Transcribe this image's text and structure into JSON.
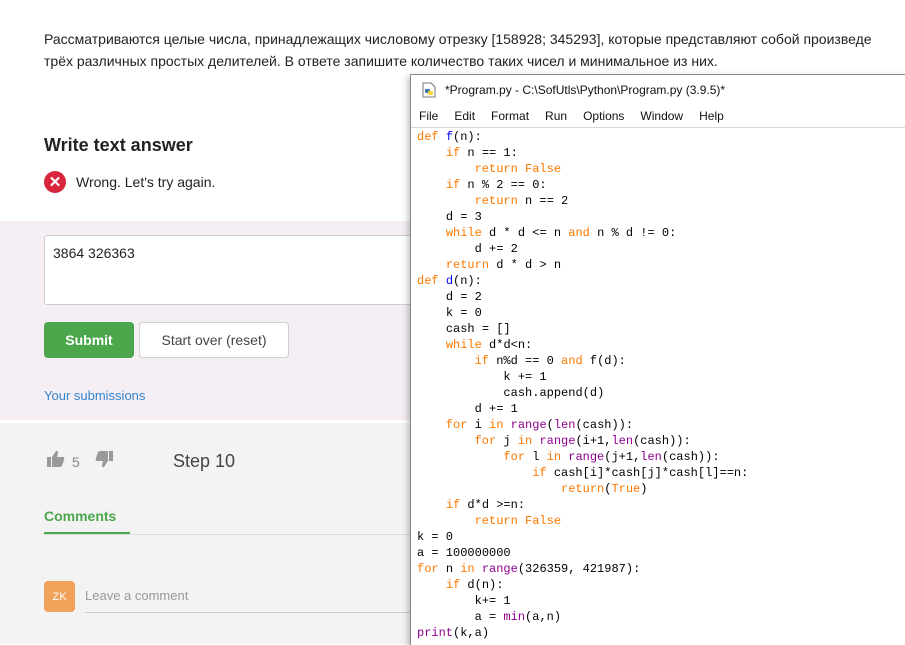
{
  "page": {
    "task_line1": "Рассматриваются целые числа, принадлежащих числовому отрезку [158928; 345293], которые представляют собой произведе",
    "task_line2": "трёх различных простых делителей. В ответе запишите количество таких чисел и минимальное из них.",
    "write_text_answer": "Write text answer",
    "wrong_message": "Wrong. Let's try again.",
    "answer_value": "3864 326363",
    "submit_label": "Submit",
    "reset_label": "Start over (reset)",
    "submissions_link": "Your submissions",
    "like_count": "5",
    "step_label": "Step 10",
    "comments_tab": "Comments",
    "avatar_initials": "ZK",
    "comment_placeholder": "Leave a comment"
  },
  "idle": {
    "title": "*Program.py - C:\\SofUtls\\Python\\Program.py (3.9.5)*",
    "menu": [
      "File",
      "Edit",
      "Format",
      "Run",
      "Options",
      "Window",
      "Help"
    ],
    "code_lines": [
      "def f(n):",
      "    if n == 1:",
      "        return False",
      "    if n % 2 == 0:",
      "        return n == 2",
      "    d = 3",
      "    while d * d <= n and n % d != 0:",
      "        d += 2",
      "    return d * d > n",
      "def d(n):",
      "    d = 2",
      "    k = 0",
      "    cash = []",
      "    while d*d<n:",
      "        if n%d == 0 and f(d):",
      "            k += 1",
      "            cash.append(d)",
      "        d += 1",
      "    for i in range(len(cash)):",
      "        for j in range(i+1,len(cash)):",
      "            for l in range(j+1,len(cash)):",
      "                if cash[i]*cash[j]*cash[l]==n:",
      "                    return(True)",
      "    if d*d >=n:",
      "        return False",
      "k = 0",
      "a = 100000000",
      "for n in range(326359, 421987):",
      "    if d(n):",
      "        k+= 1",
      "        a = min(a,n)",
      "print(k,a)"
    ]
  },
  "colors": {
    "keyword": "#ff7700",
    "builtin": "#900090",
    "defname": "#0000ff",
    "accent_green": "#4ca64c",
    "error_red": "#d9263c",
    "link_blue": "#3385cc"
  },
  "icons": [
    "error-x-icon",
    "thumbs-up-icon",
    "thumbs-down-icon",
    "python-file-icon"
  ]
}
